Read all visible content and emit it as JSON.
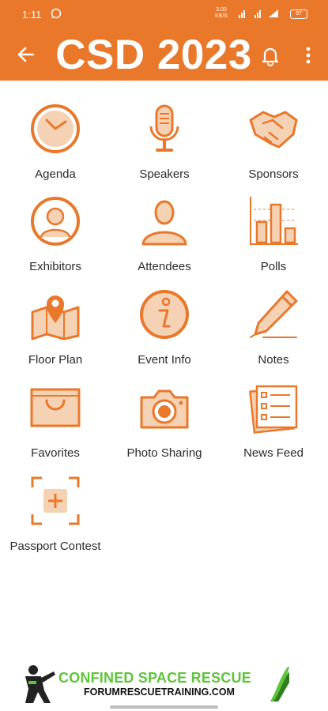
{
  "status_bar": {
    "time": "1:11",
    "network_speed": "3.00",
    "network_unit": "KB/S",
    "battery": "97"
  },
  "app_bar": {
    "title": "CSD 2023"
  },
  "colors": {
    "brand": "#e9782b",
    "icon_fill": "#f6d2b4",
    "icon_stroke": "#e9782b",
    "banner_green": "#5fc43b"
  },
  "menu": [
    {
      "label": "Agenda",
      "icon": "clock-icon"
    },
    {
      "label": "Speakers",
      "icon": "microphone-icon"
    },
    {
      "label": "Sponsors",
      "icon": "handshake-icon"
    },
    {
      "label": "Exhibitors",
      "icon": "person-circle-icon"
    },
    {
      "label": "Attendees",
      "icon": "person-icon"
    },
    {
      "label": "Polls",
      "icon": "bar-chart-icon"
    },
    {
      "label": "Floor Plan",
      "icon": "map-pin-icon"
    },
    {
      "label": "Event Info",
      "icon": "info-icon"
    },
    {
      "label": "Notes",
      "icon": "pen-icon"
    },
    {
      "label": "Favorites",
      "icon": "shopping-bag-icon"
    },
    {
      "label": "Photo Sharing",
      "icon": "camera-icon"
    },
    {
      "label": "News Feed",
      "icon": "checklist-icon"
    },
    {
      "label": "Passport Contest",
      "icon": "scan-plus-icon"
    }
  ],
  "banner": {
    "line1": "CONFINED SPACE RESCUE",
    "line2": "FORUMRESCUETRAINING.COM"
  }
}
